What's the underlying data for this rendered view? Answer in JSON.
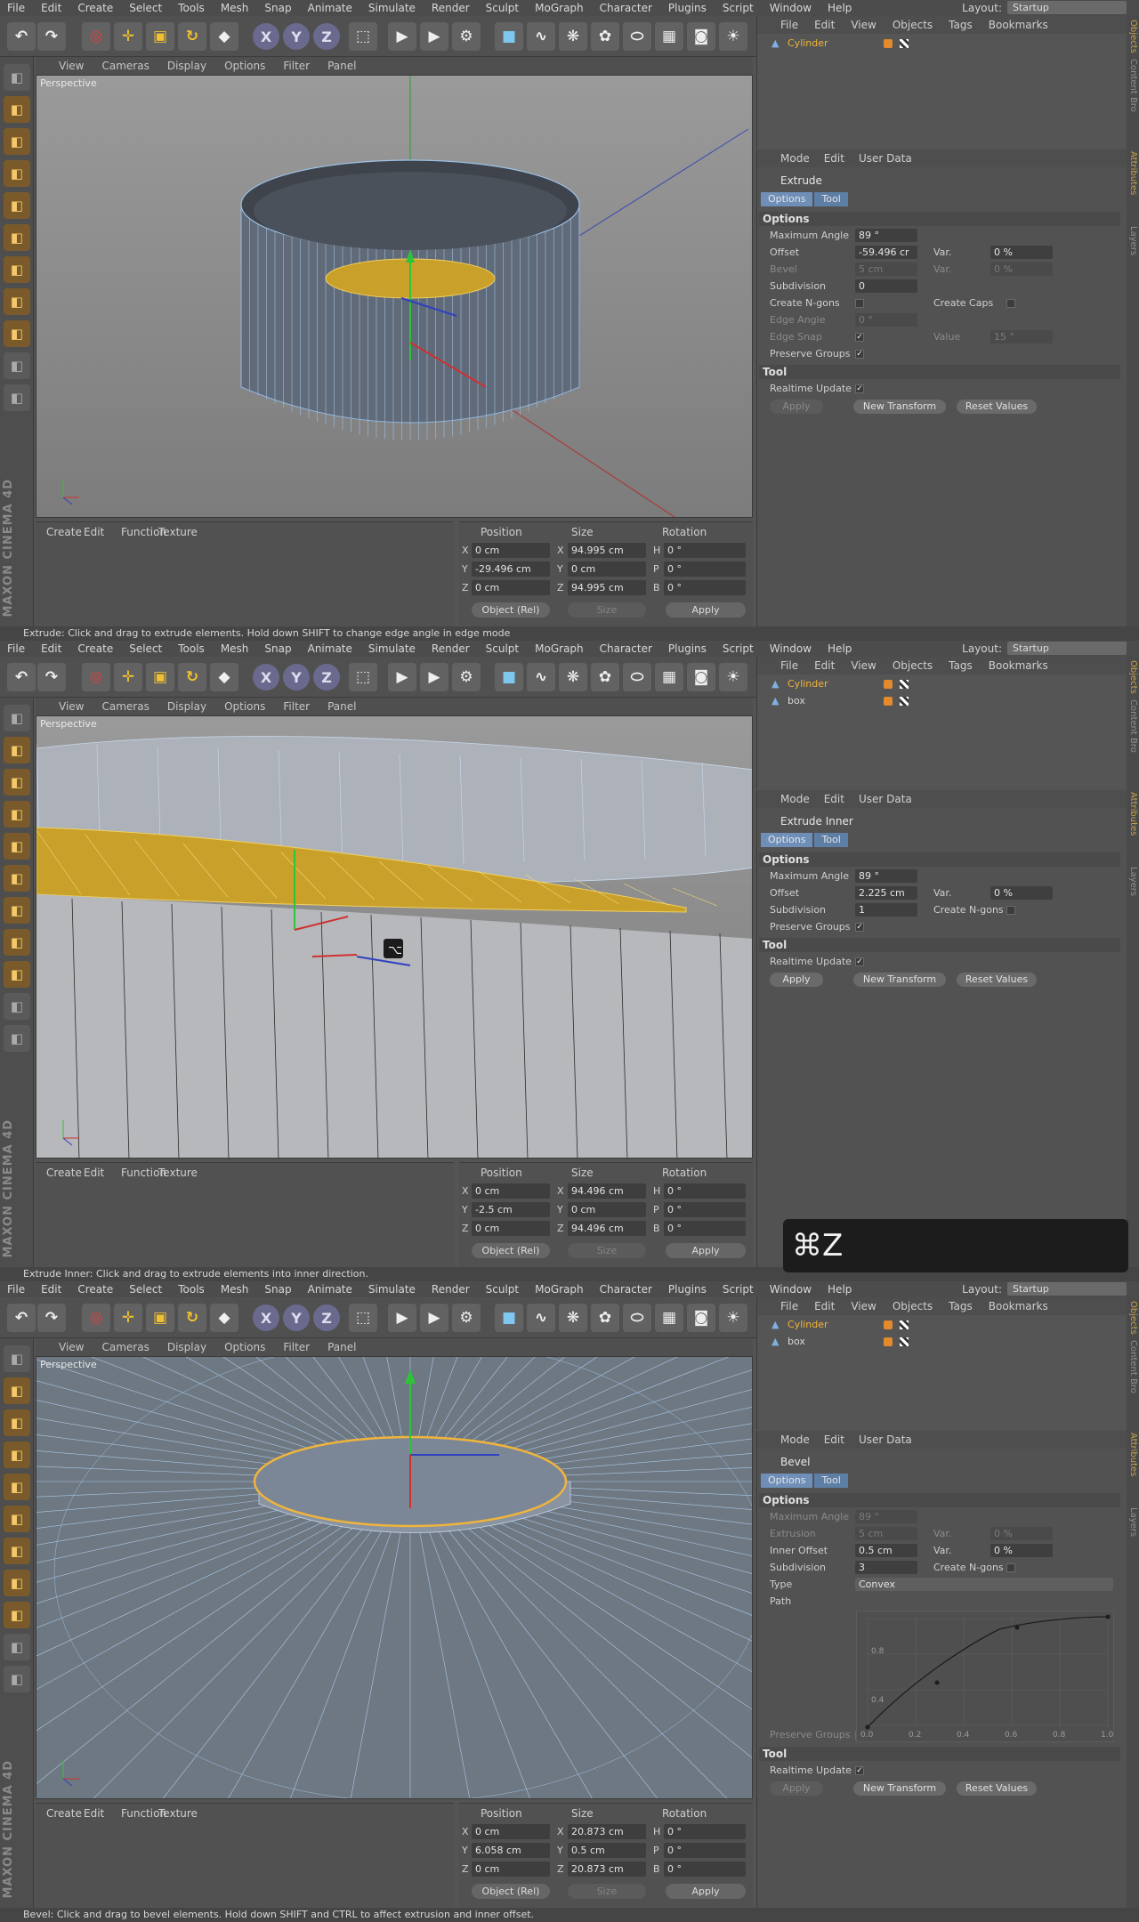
{
  "menu": [
    "File",
    "Edit",
    "Create",
    "Select",
    "Tools",
    "Mesh",
    "Snap",
    "Animate",
    "Simulate",
    "Render",
    "Sculpt",
    "MoGraph",
    "Character",
    "Plugins",
    "Script",
    "Window",
    "Help"
  ],
  "layout_label": "Layout:",
  "layout_value": "Startup",
  "viewport_menu": [
    "View",
    "Cameras",
    "Display",
    "Options",
    "Filter",
    "Panel"
  ],
  "viewport_label": "Perspective",
  "material_menu": [
    "Create",
    "Edit",
    "Function",
    "Texture"
  ],
  "object_menu": [
    "File",
    "Edit",
    "View",
    "Objects",
    "Tags",
    "Bookmarks"
  ],
  "attr_menu": [
    "Mode",
    "Edit",
    "User Data"
  ],
  "tab_options": "Options",
  "tab_tool": "Tool",
  "section_options": "Options",
  "section_tool": "Tool",
  "realtime_update": "Realtime Update",
  "apply": "Apply",
  "new_transform": "New Transform",
  "reset_values": "Reset Values",
  "coord_headers": {
    "position": "Position",
    "size": "Size",
    "rotation": "Rotation"
  },
  "coord_mode": "Object (Rel)",
  "coord_size_mode": "Size",
  "brand": "MAXON CINEMA 4D",
  "panels": [
    {
      "objects": [
        {
          "name": "Cylinder",
          "active": true
        }
      ],
      "tool_name": "Extrude",
      "props": [
        {
          "label": "Maximum Angle",
          "value": "89 °"
        },
        {
          "label": "Offset",
          "value": "-59.496 cr",
          "var_label": "Var.",
          "var_value": "0 %"
        },
        {
          "label": "Bevel",
          "value": "5 cm",
          "var_label": "Var.",
          "var_value": "0 %",
          "dim": true
        },
        {
          "label": "Subdivision",
          "value": "0"
        },
        {
          "label": "Create N-gons",
          "check": false,
          "right_label": "Create Caps"
        },
        {
          "label": "Edge Angle",
          "value": "0 °",
          "dim": true
        },
        {
          "label": "Edge Snap",
          "check": true,
          "var_label": "Value",
          "var_value": "15 °",
          "dim": true
        },
        {
          "label": "Preserve Groups",
          "check": true
        }
      ],
      "apply_dim": true,
      "coords": {
        "x": "0 cm",
        "y": "-29.496 cm",
        "z": "0 cm",
        "sx": "94.995 cm",
        "sy": "0 cm",
        "sz": "94.995 cm",
        "h": "0 °",
        "p": "0 °",
        "b": "0 °"
      },
      "status": "Extrude: Click and drag to extrude elements. Hold down SHIFT to change edge angle in edge mode"
    },
    {
      "objects": [
        {
          "name": "Cylinder",
          "active": true
        },
        {
          "name": "box",
          "active": false
        }
      ],
      "tool_name": "Extrude Inner",
      "props": [
        {
          "label": "Maximum Angle",
          "value": "89 °"
        },
        {
          "label": "Offset",
          "value": "2.225 cm",
          "var_label": "Var.",
          "var_value": "0 %"
        },
        {
          "label": "Subdivision",
          "value": "1",
          "right_label": "Create N-gons"
        },
        {
          "label": "Preserve Groups",
          "check": true
        }
      ],
      "apply_dim": false,
      "coords": {
        "x": "0 cm",
        "y": "-2.5 cm",
        "z": "0 cm",
        "sx": "94.496 cm",
        "sy": "0 cm",
        "sz": "94.496 cm",
        "h": "0 °",
        "p": "0 °",
        "b": "0 °"
      },
      "status": "Extrude Inner: Click and drag to extrude elements into inner direction.",
      "shortcut": "⌘Z"
    },
    {
      "objects": [
        {
          "name": "Cylinder",
          "active": true
        },
        {
          "name": "box",
          "active": false
        }
      ],
      "tool_name": "Bevel",
      "props": [
        {
          "label": "Maximum Angle",
          "value": "89 °",
          "dim": true
        },
        {
          "label": "Extrusion",
          "value": "5 cm",
          "var_label": "Var.",
          "var_value": "0 %",
          "dim": true
        },
        {
          "label": "Inner Offset",
          "value": "0.5 cm",
          "var_label": "Var.",
          "var_value": "0 %"
        },
        {
          "label": "Subdivision",
          "value": "3",
          "right_label": "Create N-gons"
        },
        {
          "label": "Type",
          "select": "Convex"
        },
        {
          "label": "Path"
        }
      ],
      "graph_ticks_x": [
        "0.0",
        "0.2",
        "0.4",
        "0.6",
        "0.8",
        "1.0"
      ],
      "graph_ticks_y": [
        "0.8",
        "0.4"
      ],
      "preserve_groups": "Preserve Groups",
      "apply_dim": true,
      "coords": {
        "x": "0 cm",
        "y": "6.058 cm",
        "z": "0 cm",
        "sx": "20.873 cm",
        "sy": "0.5 cm",
        "sz": "20.873 cm",
        "h": "0 °",
        "p": "0 °",
        "b": "0 °"
      },
      "status": "Bevel: Click and drag to bevel elements. Hold down SHIFT and CTRL to affect extrusion and inner offset."
    }
  ],
  "side_tabs": [
    "Objects",
    "Content Bro",
    "Attributes",
    "Layers"
  ]
}
